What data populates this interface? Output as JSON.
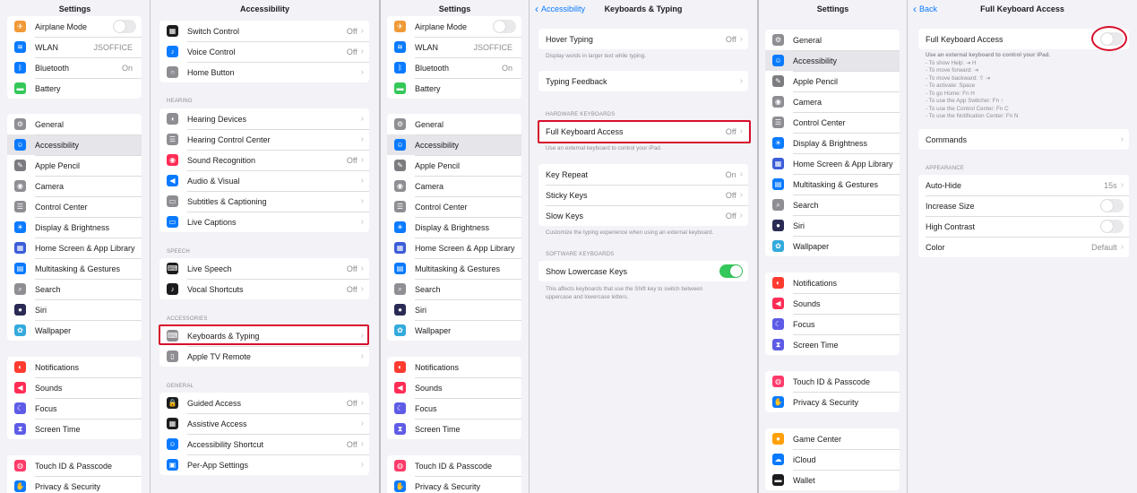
{
  "colors": {
    "accent": "#0a7aff",
    "highlight": "#d70f2b",
    "toggle_on": "#34c759",
    "selected_row": "#e5e5ea"
  },
  "icons": {
    "airplane": [
      "#f09a37",
      "✈"
    ],
    "wifi": [
      "#0a7aff",
      "≋"
    ],
    "bluetooth": [
      "#0a7aff",
      "ᛒ"
    ],
    "battery": [
      "#34c759",
      "▬"
    ],
    "general": [
      "#8e8e93",
      "⚙"
    ],
    "accessibility": [
      "#0a7aff",
      "☺"
    ],
    "pencil": [
      "#7c7c80",
      "✎"
    ],
    "camera": [
      "#8e8e93",
      "◉"
    ],
    "control": [
      "#8e8e93",
      "☰"
    ],
    "display": [
      "#0a7aff",
      "☀"
    ],
    "homescreen": [
      "#3c5dd8",
      "▦"
    ],
    "multitask": [
      "#0a7aff",
      "▤"
    ],
    "search": [
      "#8e8e93",
      "⌕"
    ],
    "siri": [
      "#2a2a55",
      "●"
    ],
    "wallpaper": [
      "#34aadc",
      "✿"
    ],
    "notifications": [
      "#ff3b30",
      "◐"
    ],
    "sounds": [
      "#ff2d55",
      "◀"
    ],
    "focus": [
      "#5e5ce6",
      "☾"
    ],
    "screentime": [
      "#5e5ce6",
      "⧗"
    ],
    "touchid": [
      "#ff3b6a",
      "◍"
    ],
    "privacy": [
      "#0a7aff",
      "✋"
    ],
    "switch": [
      "#1c1c1e",
      "▦"
    ],
    "voice": [
      "#0a7aff",
      "♪"
    ],
    "home": [
      "#8e8e93",
      "○"
    ],
    "hearing": [
      "#8e8e93",
      "◖"
    ],
    "hearingcc": [
      "#8e8e93",
      "☰"
    ],
    "soundrec": [
      "#ff2d55",
      "◉"
    ],
    "audio": [
      "#0a7aff",
      "◀"
    ],
    "subtitles": [
      "#8e8e93",
      "▭"
    ],
    "livecap": [
      "#0a7aff",
      "▭"
    ],
    "livespeech": [
      "#1c1c1e",
      "⌨"
    ],
    "vocal": [
      "#1c1c1e",
      "♪"
    ],
    "keyboard": [
      "#8e8e93",
      "⌨"
    ],
    "appletv": [
      "#8e8e93",
      "▯"
    ],
    "guided": [
      "#1c1c1e",
      "🔒"
    ],
    "assistive": [
      "#1c1c1e",
      "▦"
    ],
    "shortcut": [
      "#0a7aff",
      "☺"
    ],
    "perapp": [
      "#0a7aff",
      "▣"
    ],
    "gamecenter": [
      "#ff9f0a",
      "●"
    ],
    "icloud": [
      "#0a7aff",
      "☁"
    ],
    "wallet": [
      "#1c1c1e",
      "▬"
    ]
  },
  "p1": {
    "title": "Settings",
    "g1": [
      {
        "label": "Airplane Mode",
        "icon": "airplane",
        "toggle": "off"
      },
      {
        "label": "WLAN",
        "icon": "wifi",
        "value": "JSOFFICE"
      },
      {
        "label": "Bluetooth",
        "icon": "bluetooth",
        "value": "On"
      },
      {
        "label": "Battery",
        "icon": "battery"
      }
    ],
    "g2": [
      {
        "label": "General",
        "icon": "general"
      },
      {
        "label": "Accessibility",
        "icon": "accessibility",
        "selected": true
      },
      {
        "label": "Apple Pencil",
        "icon": "pencil"
      },
      {
        "label": "Camera",
        "icon": "camera"
      },
      {
        "label": "Control Center",
        "icon": "control"
      },
      {
        "label": "Display & Brightness",
        "icon": "display"
      },
      {
        "label": "Home Screen & App Library",
        "icon": "homescreen"
      },
      {
        "label": "Multitasking & Gestures",
        "icon": "multitask"
      },
      {
        "label": "Search",
        "icon": "search"
      },
      {
        "label": "Siri",
        "icon": "siri"
      },
      {
        "label": "Wallpaper",
        "icon": "wallpaper"
      }
    ],
    "g3": [
      {
        "label": "Notifications",
        "icon": "notifications"
      },
      {
        "label": "Sounds",
        "icon": "sounds"
      },
      {
        "label": "Focus",
        "icon": "focus"
      },
      {
        "label": "Screen Time",
        "icon": "screentime"
      }
    ],
    "g4": [
      {
        "label": "Touch ID & Passcode",
        "icon": "touchid"
      },
      {
        "label": "Privacy & Security",
        "icon": "privacy"
      }
    ]
  },
  "p2": {
    "title": "Accessibility",
    "g1": [
      {
        "label": "Switch Control",
        "icon": "switch",
        "value": "Off",
        "chevron": true
      },
      {
        "label": "Voice Control",
        "icon": "voice",
        "value": "Off",
        "chevron": true
      },
      {
        "label": "Home Button",
        "icon": "home",
        "chevron": true
      }
    ],
    "h_hearing": "HEARING",
    "g2": [
      {
        "label": "Hearing Devices",
        "icon": "hearing",
        "chevron": true
      },
      {
        "label": "Hearing Control Center",
        "icon": "hearingcc",
        "chevron": true
      },
      {
        "label": "Sound Recognition",
        "icon": "soundrec",
        "value": "Off",
        "chevron": true
      },
      {
        "label": "Audio & Visual",
        "icon": "audio",
        "chevron": true
      },
      {
        "label": "Subtitles & Captioning",
        "icon": "subtitles",
        "chevron": true
      },
      {
        "label": "Live Captions",
        "icon": "livecap",
        "chevron": true
      }
    ],
    "h_speech": "SPEECH",
    "g3": [
      {
        "label": "Live Speech",
        "icon": "livespeech",
        "value": "Off",
        "chevron": true
      },
      {
        "label": "Vocal Shortcuts",
        "icon": "vocal",
        "value": "Off",
        "chevron": true
      }
    ],
    "h_accessories": "ACCESSORIES",
    "g4": [
      {
        "label": "Keyboards & Typing",
        "icon": "keyboard",
        "chevron": true
      },
      {
        "label": "Apple TV Remote",
        "icon": "appletv",
        "chevron": true
      }
    ],
    "h_general": "GENERAL",
    "g5": [
      {
        "label": "Guided Access",
        "icon": "guided",
        "value": "Off",
        "chevron": true
      },
      {
        "label": "Assistive Access",
        "icon": "assistive",
        "chevron": true
      },
      {
        "label": "Accessibility Shortcut",
        "icon": "shortcut",
        "value": "Off",
        "chevron": true
      },
      {
        "label": "Per-App Settings",
        "icon": "perapp",
        "chevron": true
      }
    ]
  },
  "p4": {
    "title": "Keyboards & Typing",
    "back": "Accessibility",
    "g1": [
      {
        "label": "Hover Typing",
        "value": "Off",
        "chevron": true
      }
    ],
    "note1": [
      "Display words in larger text while typing."
    ],
    "g2": [
      {
        "label": "Typing Feedback",
        "chevron": true
      }
    ],
    "h_hw": "HARDWARE KEYBOARDS",
    "g3": [
      {
        "label": "Full Keyboard Access",
        "value": "Off",
        "chevron": true
      }
    ],
    "note2": [
      "Use an external keyboard to control your iPad."
    ],
    "g4": [
      {
        "label": "Key Repeat",
        "value": "On",
        "chevron": true
      },
      {
        "label": "Sticky Keys",
        "value": "Off",
        "chevron": true
      },
      {
        "label": "Slow Keys",
        "value": "Off",
        "chevron": true
      }
    ],
    "note3": [
      "Customize the typing experience when using an external keyboard."
    ],
    "h_sw": "SOFTWARE KEYBOARDS",
    "g5": [
      {
        "label": "Show Lowercase Keys",
        "toggle": "on"
      }
    ],
    "note4": [
      "This affects keyboards that use the Shift key to switch between",
      "uppercase and lowercase letters."
    ]
  },
  "p5": {
    "title": "Settings",
    "g1": [
      {
        "label": "General",
        "icon": "general"
      },
      {
        "label": "Accessibility",
        "icon": "accessibility",
        "selected": true
      },
      {
        "label": "Apple Pencil",
        "icon": "pencil"
      },
      {
        "label": "Camera",
        "icon": "camera"
      },
      {
        "label": "Control Center",
        "icon": "control"
      },
      {
        "label": "Display & Brightness",
        "icon": "display"
      },
      {
        "label": "Home Screen & App Library",
        "icon": "homescreen"
      },
      {
        "label": "Multitasking & Gestures",
        "icon": "multitask"
      },
      {
        "label": "Search",
        "icon": "search"
      },
      {
        "label": "Siri",
        "icon": "siri"
      },
      {
        "label": "Wallpaper",
        "icon": "wallpaper"
      }
    ],
    "g2": [
      {
        "label": "Notifications",
        "icon": "notifications"
      },
      {
        "label": "Sounds",
        "icon": "sounds"
      },
      {
        "label": "Focus",
        "icon": "focus"
      },
      {
        "label": "Screen Time",
        "icon": "screentime"
      }
    ],
    "g3": [
      {
        "label": "Touch ID & Passcode",
        "icon": "touchid"
      },
      {
        "label": "Privacy & Security",
        "icon": "privacy"
      }
    ],
    "g4": [
      {
        "label": "Game Center",
        "icon": "gamecenter"
      },
      {
        "label": "iCloud",
        "icon": "icloud"
      },
      {
        "label": "Wallet",
        "icon": "wallet"
      }
    ]
  },
  "p6": {
    "title": "Full Keyboard Access",
    "back": "Back",
    "g1": [
      {
        "label": "Full Keyboard Access",
        "toggle": "off"
      }
    ],
    "note_title": "Use an external keyboard to control your iPad.",
    "shortcuts": [
      "To show Help: ⇥ H",
      "To move forward: ⇥",
      "To move backward: ⇧ ⇥",
      "To activate: Space",
      "To go Home: Fn H",
      "To use the App Switcher: Fn ↑",
      "To use the Control Center: Fn C",
      "To use the Notification Center: Fn N"
    ],
    "g2": [
      {
        "label": "Commands",
        "chevron": true
      }
    ],
    "h_appearance": "APPEARANCE",
    "g3": [
      {
        "label": "Auto-Hide",
        "value": "15s",
        "chevron": true
      },
      {
        "label": "Increase Size",
        "toggle": "off"
      },
      {
        "label": "High Contrast",
        "toggle": "off"
      },
      {
        "label": "Color",
        "value": "Default",
        "chevron": true
      }
    ]
  }
}
